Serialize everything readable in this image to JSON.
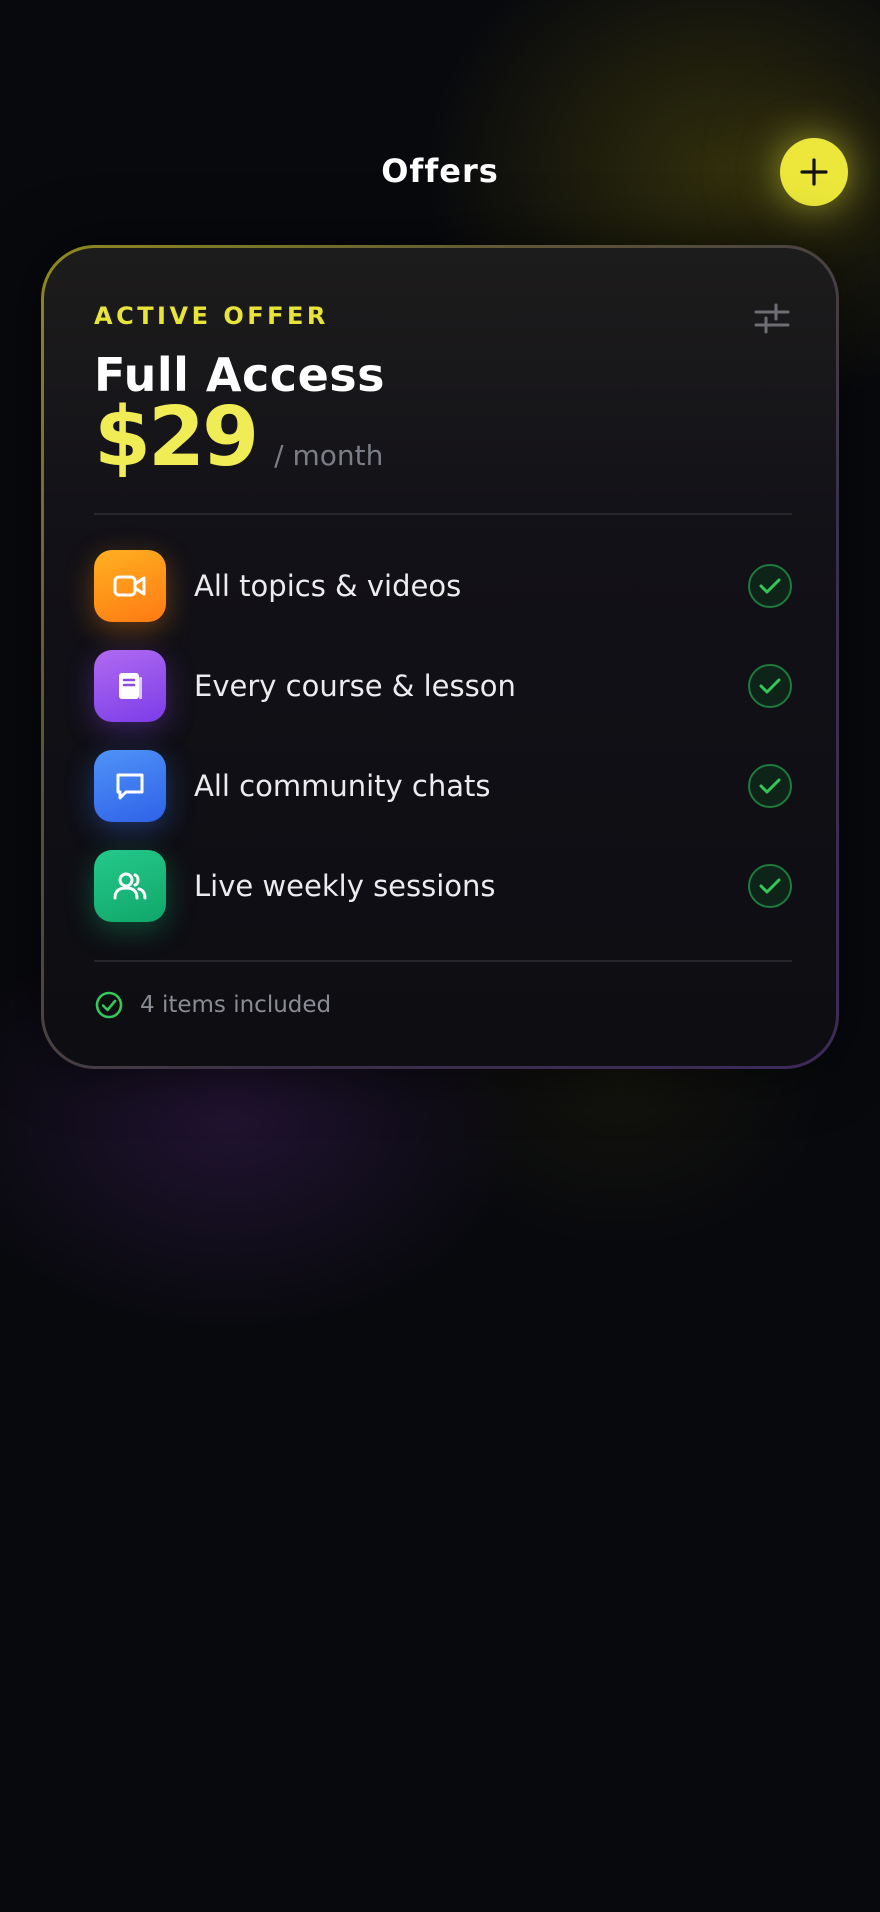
{
  "header": {
    "title": "Offers",
    "add_icon": "plus-icon"
  },
  "offer_card": {
    "eyebrow": "ACTIVE OFFER",
    "settings_icon": "sliders-icon",
    "plan_name": "Full Access",
    "price": "$29",
    "period": "/ month",
    "features": [
      {
        "label": "All topics & videos",
        "icon": "video-camera-icon",
        "color_from": "#ffb020",
        "color_to": "#ff7a14",
        "included": true
      },
      {
        "label": "Every course & lesson",
        "icon": "book-icon",
        "color_from": "#b06bf0",
        "color_to": "#7c3ce8",
        "included": true
      },
      {
        "label": "All community chats",
        "icon": "chat-bubble-icon",
        "color_from": "#4f93f7",
        "color_to": "#2f62e8",
        "included": true
      },
      {
        "label": "Live weekly sessions",
        "icon": "users-icon",
        "color_from": "#24c98a",
        "color_to": "#10a76a",
        "included": true
      }
    ],
    "footer_text": "4 items included",
    "footer_icon": "check-circle-icon"
  },
  "colors": {
    "accent_yellow": "#ece73a",
    "check_green": "#34c759",
    "background": "#08090d"
  }
}
